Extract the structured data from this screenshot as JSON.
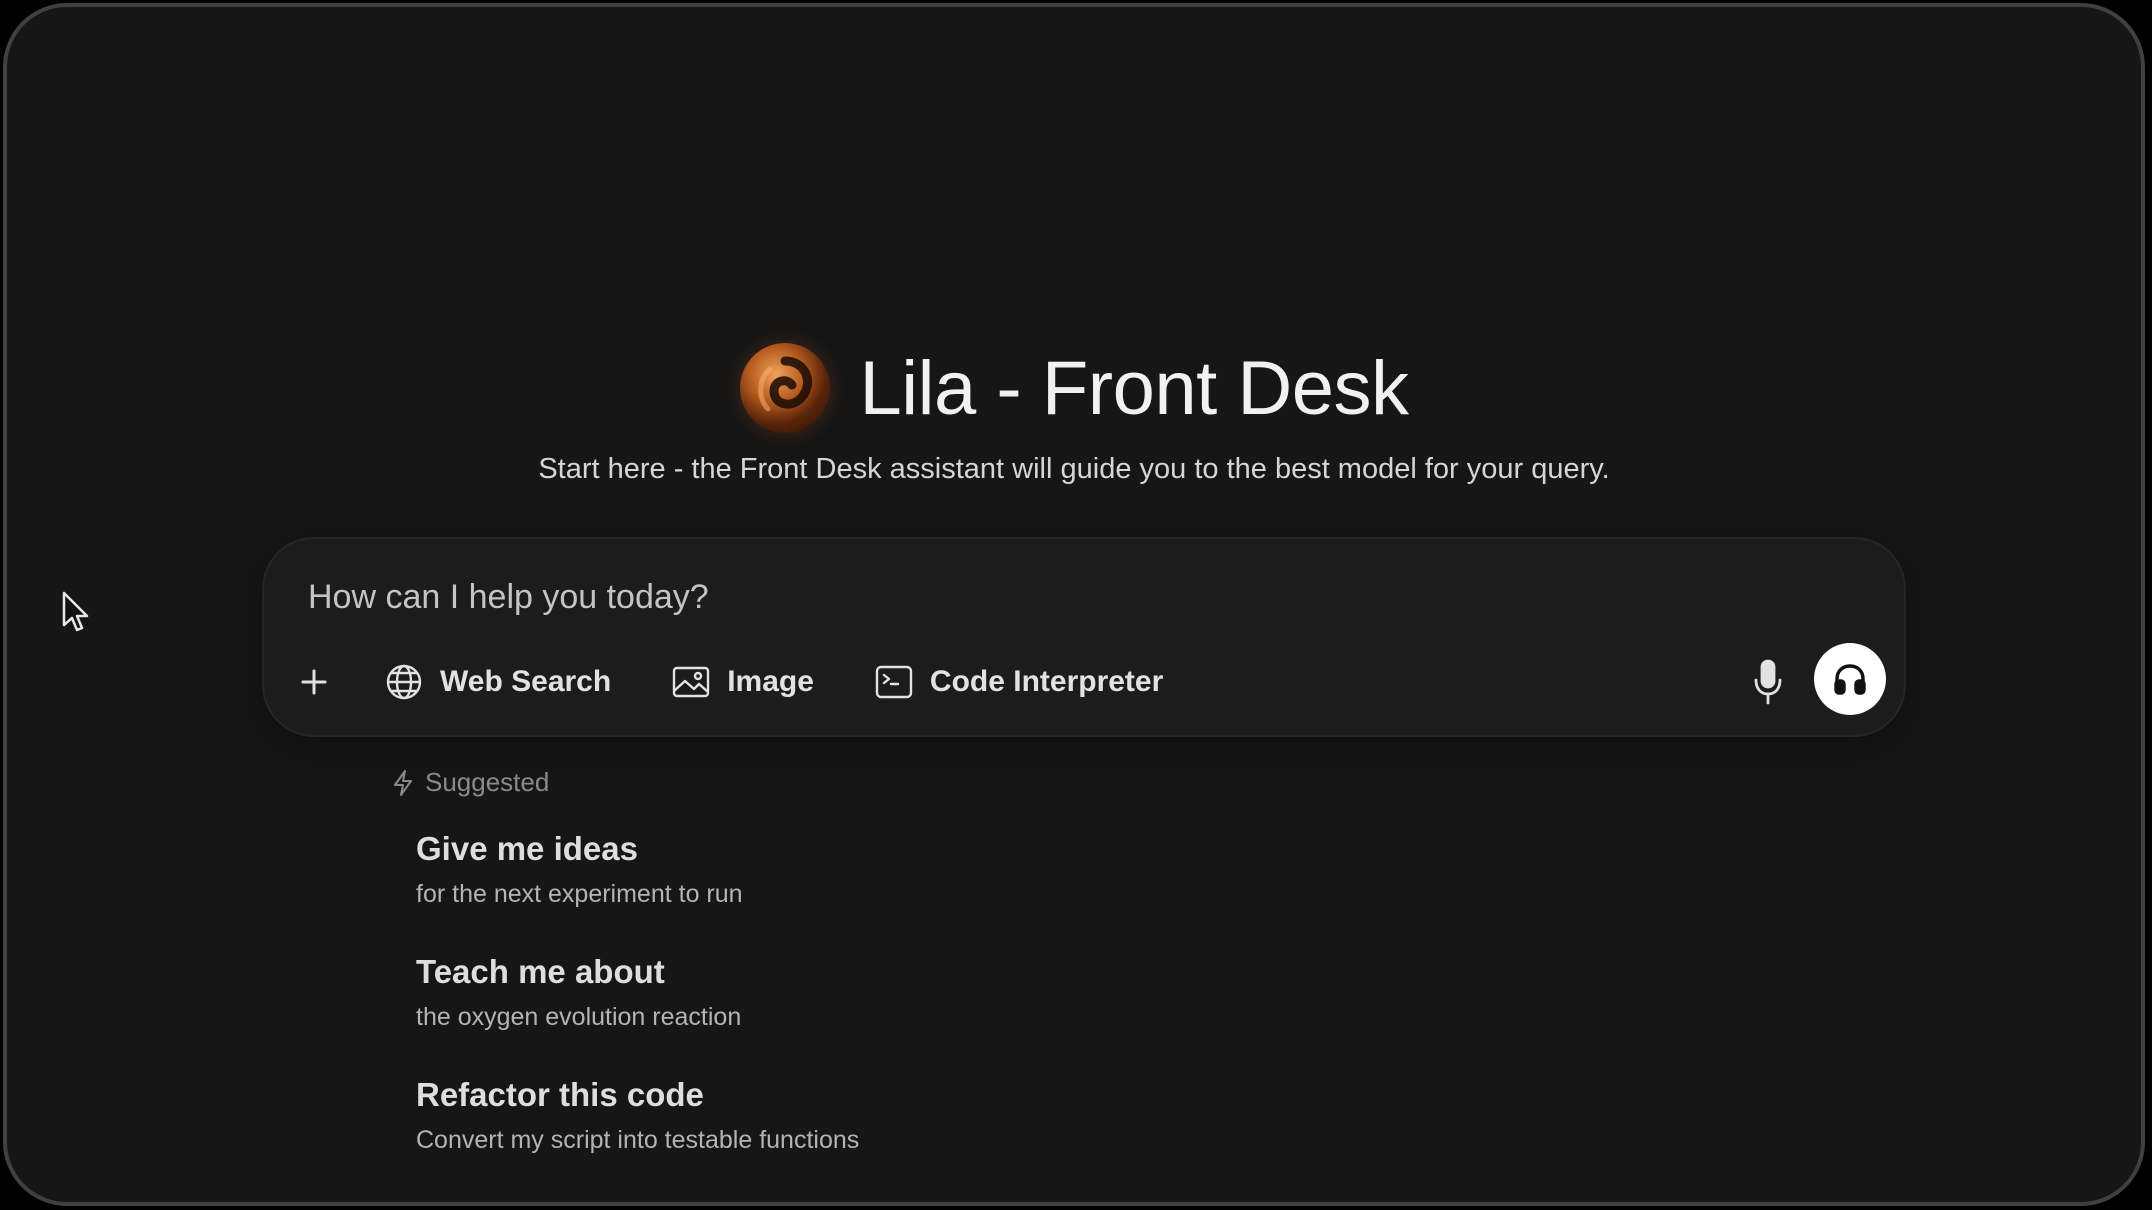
{
  "app": {
    "title": "Lila - Front Desk",
    "subtitle": "Start here - the Front Desk assistant will guide you to the best model for your query.",
    "logo_icon": "swirl-logo-icon"
  },
  "composer": {
    "placeholder": "How can I help you today?",
    "value": "",
    "tools": [
      {
        "icon": "plus-icon",
        "label": ""
      },
      {
        "icon": "globe-icon",
        "label": "Web Search"
      },
      {
        "icon": "image-icon",
        "label": "Image"
      },
      {
        "icon": "terminal-icon",
        "label": "Code Interpreter"
      }
    ],
    "mic_icon": "microphone-icon",
    "voice_icon": "headphones-icon"
  },
  "suggestions": {
    "header": "Suggested",
    "header_icon": "lightning-icon",
    "items": [
      {
        "title": "Give me ideas",
        "subtitle": "for the next experiment to run"
      },
      {
        "title": "Teach me about",
        "subtitle": "the oxygen evolution reaction"
      },
      {
        "title": "Refactor this code",
        "subtitle": "Convert my script into testable functions"
      }
    ]
  },
  "colors": {
    "background": "#161616",
    "composer": "#1c1c1c",
    "text_primary": "#f1f1f1",
    "text_muted": "#8a8a8a",
    "voice_button": "#ffffff",
    "logo_accent": "#b35a1e"
  }
}
